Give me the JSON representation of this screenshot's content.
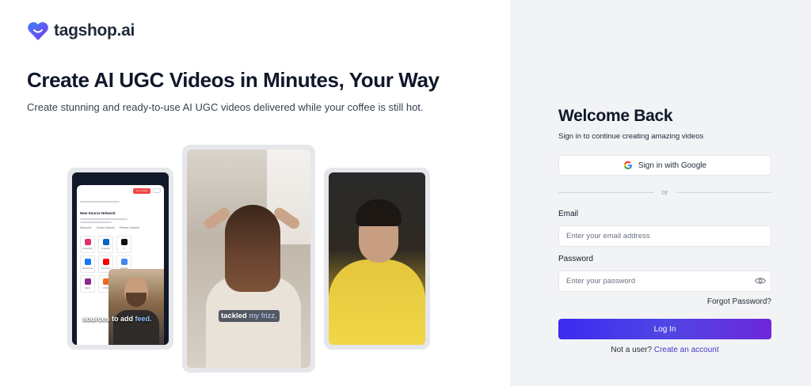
{
  "brand": {
    "name": "tagshop.ai",
    "logo_icon": "heart-icon",
    "brand_color": "#5b3df5"
  },
  "hero": {
    "title": "Create AI UGC Videos in Minutes, Your Way",
    "subtitle": "Create stunning and ready-to-use AI UGC videos delivered while your coffee is still hot.",
    "phones": [
      {
        "caption_plain": "sources to add ",
        "caption_highlight": "feed.",
        "mock_heading": "New Source Network",
        "mock_button": "Yo Ti Conte",
        "mock_tabs": [
          "Networks",
          "Social Network",
          "Partner Network"
        ],
        "mock_tiles": [
          {
            "label": "Instagram",
            "color": "#e1306c"
          },
          {
            "label": "LinkedIn",
            "color": "#0a66c2"
          },
          {
            "label": "X",
            "color": "#111111"
          },
          {
            "label": "Facebook",
            "color": "#1877f2"
          },
          {
            "label": "YouTube",
            "color": "#ff0000"
          },
          {
            "label": "Google",
            "color": "#4285f4"
          },
          {
            "label": "Slack",
            "color": "#8b2b8e"
          },
          {
            "label": "RSS",
            "color": "#f26522"
          },
          {
            "label": "Amazon",
            "color": "#232f3e"
          }
        ]
      },
      {
        "caption_bold": "tackled",
        "caption_dim": " my frizz,"
      }
    ]
  },
  "login": {
    "title": "Welcome Back",
    "subtitle": "Sign in to continue creating amazing videos",
    "google_label": "Sign in with Google",
    "divider_label": "or",
    "email_label": "Email",
    "email_placeholder": "Enter your email address",
    "password_label": "Password",
    "password_placeholder": "Enter your password",
    "forgot_label": "Forgot Password?",
    "login_label": "Log In",
    "signup_prompt": "Not a user? ",
    "signup_link": "Create an account",
    "accent_color": "#4338ca"
  }
}
